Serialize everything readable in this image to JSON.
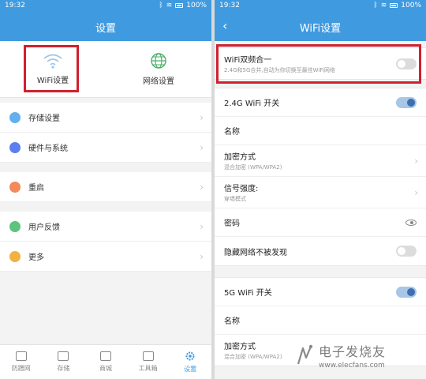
{
  "left": {
    "status": {
      "time": "19:32",
      "battery": "100%"
    },
    "title": "设置",
    "quick_actions": [
      {
        "label": "WiFi设置",
        "icon": "wifi-icon"
      },
      {
        "label": "网络设置",
        "icon": "globe-icon"
      }
    ],
    "menu_groups": [
      [
        {
          "label": "存储设置",
          "icon": "storage-icon",
          "color": "#64b0ee"
        },
        {
          "label": "硬件与系统",
          "icon": "hardware-icon",
          "color": "#5c7ff0"
        }
      ],
      [
        {
          "label": "重启",
          "icon": "restart-icon",
          "color": "#f28a5a"
        }
      ],
      [
        {
          "label": "用户反馈",
          "icon": "feedback-icon",
          "color": "#5cc47b"
        },
        {
          "label": "更多",
          "icon": "more-icon",
          "color": "#f0b240"
        }
      ]
    ],
    "tabs": [
      {
        "label": "防蹭网",
        "icon": "shield-icon",
        "active": false
      },
      {
        "label": "存储",
        "icon": "download-icon",
        "active": false
      },
      {
        "label": "商城",
        "icon": "bag-icon",
        "active": false
      },
      {
        "label": "工具箱",
        "icon": "toolbox-icon",
        "active": false
      },
      {
        "label": "设置",
        "icon": "gear-icon",
        "active": true
      }
    ],
    "highlight_color": "#d1202f"
  },
  "right": {
    "status": {
      "time": "19:32",
      "battery": "100%"
    },
    "title": "WiFi设置",
    "merge": {
      "title": "WiFi双频合一",
      "subtitle": "2.4G和5G合并,自动为你切换至最佳WiFi网络",
      "enabled": false
    },
    "band_24": {
      "switch_label": "2.4G WiFi 开关",
      "switch_on": true,
      "name_label": "名称",
      "encryption": {
        "label": "加密方式",
        "value": "混合加密 (WPA/WPA2)"
      },
      "signal": {
        "label": "信号强度:",
        "value": "穿墙模式"
      },
      "password_label": "密码",
      "hidden": {
        "label": "隐藏网络不被发现",
        "enabled": false
      }
    },
    "band_5g": {
      "switch_label": "5G WiFi 开关",
      "switch_on": true,
      "name_label": "名称",
      "encryption": {
        "label": "加密方式",
        "value": "混合加密 (WPA/WPA2)"
      }
    }
  },
  "watermark": {
    "cn": "电子发烧友",
    "en": "www.elecfans.com"
  }
}
